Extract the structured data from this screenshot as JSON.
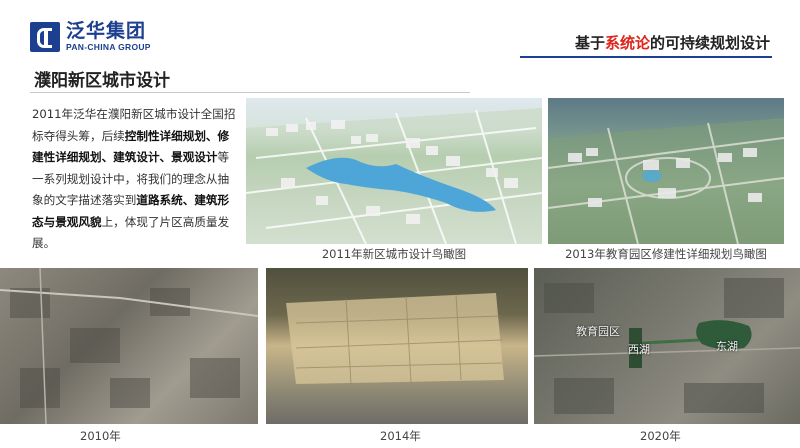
{
  "brand": {
    "cn": "泛华集团",
    "en": "PAN-CHINA GROUP",
    "color": "#1c3f8f"
  },
  "header": {
    "title_pre": "基于",
    "title_hl": "系统论",
    "title_post": "的可持续规划设计",
    "accent": "#e0241b"
  },
  "section_title": "濮阳新区城市设计",
  "paragraph": {
    "t1": "2011年泛华在濮阳新区城市设计全国招标夺得头筹，后续",
    "b1": "控制性详细规划、修建性详细规划、建筑设计、景观设计",
    "t2": "等一系列规划设计中，将我们的理念从抽象的文字描述落实到",
    "b2": "道路系统、建筑形态与景观风貌",
    "t3": "上，体现了片区高质量发展。"
  },
  "captions": {
    "render1": "2011年新区城市设计鸟瞰图",
    "render2": "2013年教育园区修建性详细规划鸟瞰图"
  },
  "satellite": {
    "years": [
      "2010年",
      "2014年",
      "2020年"
    ],
    "labels": {
      "edu": "教育园区",
      "west_lake": "西湖",
      "east_lake": "东湖"
    }
  }
}
